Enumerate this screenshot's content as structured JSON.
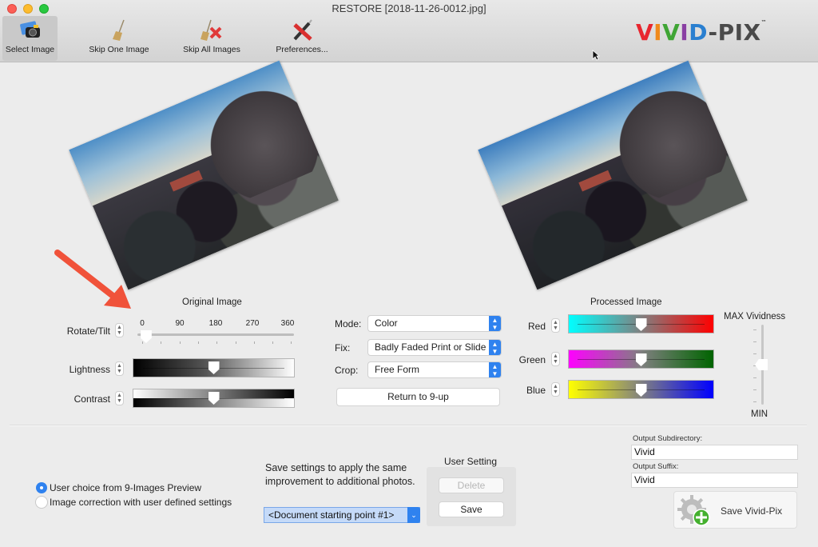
{
  "window": {
    "title": "RESTORE [2018-11-26-0012.jpg]"
  },
  "toolbar": {
    "items": [
      {
        "label": "Select Image",
        "icon": "camera-icon",
        "active": true
      },
      {
        "label": "Skip One Image",
        "icon": "broom-icon",
        "active": false
      },
      {
        "label": "Skip All Images",
        "icon": "broom-x-icon",
        "active": false
      },
      {
        "label": "Preferences...",
        "icon": "tools-icon",
        "active": false
      }
    ],
    "logo": {
      "letters": [
        {
          "ch": "V",
          "color": "#e8262f"
        },
        {
          "ch": "I",
          "color": "#f08a1c"
        },
        {
          "ch": "V",
          "color": "#3fa535"
        },
        {
          "ch": "I",
          "color": "#8a3fa3"
        },
        {
          "ch": "D",
          "color": "#2a7fd0"
        },
        {
          "ch": "-PIX",
          "color": "#4a4a4a"
        }
      ],
      "tm": "™"
    }
  },
  "original": {
    "title": "Original Image",
    "rotate": {
      "label": "Rotate/Tilt",
      "ticks": [
        "0",
        "90",
        "180",
        "270",
        "360"
      ],
      "value_deg": 20,
      "max_deg": 360
    },
    "lightness": {
      "label": "Lightness",
      "value_fraction": 0.5
    },
    "contrast": {
      "label": "Contrast",
      "value_fraction": 0.5
    }
  },
  "options": {
    "mode": {
      "label": "Mode:",
      "value": "Color"
    },
    "fix": {
      "label": "Fix:",
      "value": "Badly Faded Print or Slide"
    },
    "crop": {
      "label": "Crop:",
      "value": "Free Form"
    },
    "return_button": "Return to 9-up"
  },
  "processed": {
    "title": "Processed Image",
    "channels": [
      {
        "label": "Red",
        "from": "#00ffff",
        "to": "#ff0000",
        "value_fraction": 0.5
      },
      {
        "label": "Green",
        "from": "#ff00ff",
        "to": "#006400",
        "value_fraction": 0.5
      },
      {
        "label": "Blue",
        "from": "#ffff00",
        "to": "#0000ff",
        "value_fraction": 0.5
      }
    ],
    "vividness": {
      "max_label": "MAX Vividness",
      "min_label": "MIN",
      "value_fraction": 0.5
    }
  },
  "bottom": {
    "radios": [
      {
        "label": "User choice from 9-Images Preview",
        "selected": true
      },
      {
        "label": "Image correction with user defined settings",
        "selected": false
      }
    ],
    "description_line1": "Save settings to apply the same",
    "description_line2": "improvement to additional photos.",
    "preset_select": "<Document starting point #1>",
    "user_setting": {
      "title": "User Setting",
      "delete_label": "Delete",
      "save_label": "Save"
    },
    "output_subdirectory": {
      "label": "Output Subdirectory:",
      "value": "Vivid"
    },
    "output_suffix": {
      "label": "Output Suffix:",
      "value": "Vivid"
    },
    "save_vividpix_label": "Save Vivid-Pix"
  },
  "colors": {
    "accent": "#2f82ef",
    "annotation_arrow": "#f0523a"
  }
}
